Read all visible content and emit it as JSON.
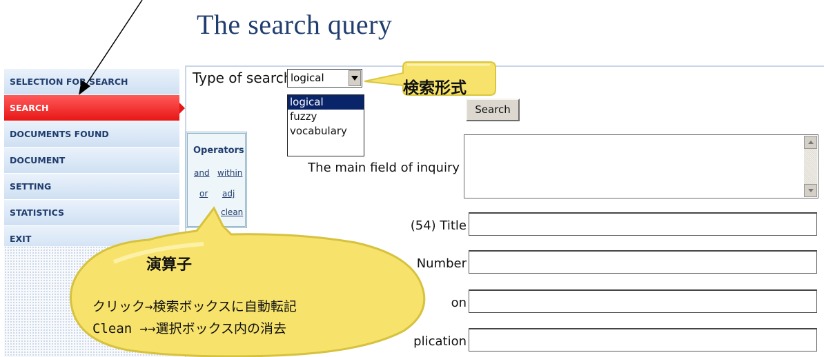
{
  "page": {
    "title": "The search query"
  },
  "sidebar": {
    "items": [
      {
        "label": "SELECTION FOR SEARCH DATABASE",
        "active": false
      },
      {
        "label": "SEARCH",
        "active": true
      },
      {
        "label": "DOCUMENTS FOUND",
        "active": false
      },
      {
        "label": "DOCUMENT",
        "active": false
      },
      {
        "label": "SETTING",
        "active": false
      },
      {
        "label": "STATISTICS",
        "active": false
      },
      {
        "label": "EXIT",
        "active": false
      }
    ]
  },
  "search_form": {
    "type_label": "Type of search",
    "type_selected": "logical",
    "type_options": [
      "logical",
      "fuzzy",
      "vocabulary"
    ],
    "search_button": "Search",
    "main_field_label": "The main field of inquiry",
    "fields": [
      {
        "label": "(54) Title",
        "value": ""
      },
      {
        "label": "Number",
        "value": ""
      },
      {
        "label": "on",
        "value": ""
      },
      {
        "label": "plication",
        "value": ""
      }
    ]
  },
  "operators": {
    "title": "Operators",
    "links": [
      "and",
      "within",
      "or",
      "adj",
      "clean"
    ]
  },
  "callouts": {
    "search_type": "検索形式",
    "operators_title": "演算子",
    "operators_line1": "クリック→検索ボックスに自動転記",
    "operators_line2": "Clean →→選択ボックス内の消去"
  },
  "colors": {
    "title_blue": "#1f3d6e",
    "active_red": "#e81616",
    "callout_yellow": "#f7e36b",
    "selected_option": "#0a246a"
  }
}
